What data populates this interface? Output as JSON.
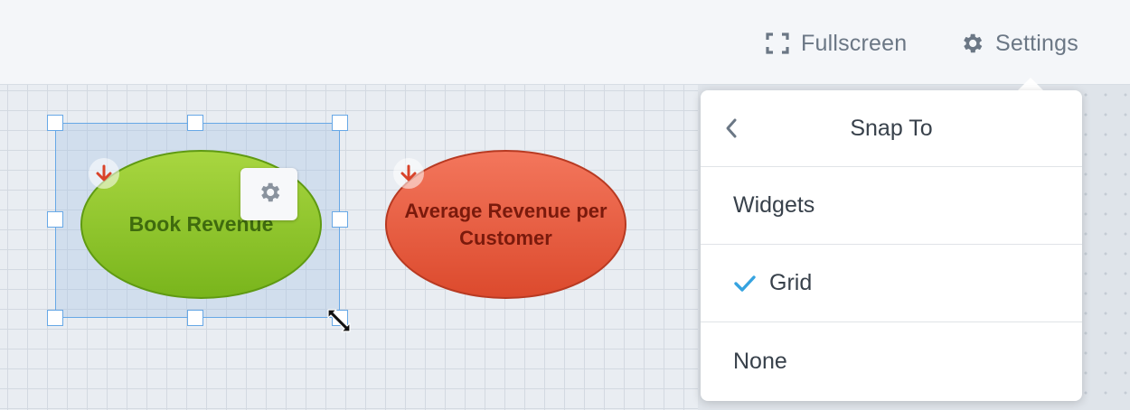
{
  "toolbar": {
    "fullscreen_label": "Fullscreen",
    "fullscreen_icon": "fullscreen-icon",
    "settings_label": "Settings",
    "settings_icon": "gear-icon"
  },
  "canvas": {
    "nodes": [
      {
        "label": "Book Revenue",
        "color": "#8cc631",
        "selected": true,
        "badge_icon": "arrow-down-icon"
      },
      {
        "label": "Average Revenue per Customer",
        "color": "#ec5a3e",
        "selected": false,
        "badge_icon": "arrow-down-icon"
      }
    ],
    "selected_node_action_icon": "gear-icon",
    "cursor_icon": "resize-diagonal-icon"
  },
  "snap_menu": {
    "title": "Snap To",
    "back_icon": "chevron-left-icon",
    "items": [
      {
        "label": "Widgets",
        "checked": false
      },
      {
        "label": "Grid",
        "checked": true
      },
      {
        "label": "None",
        "checked": false
      }
    ],
    "check_color": "#36a3e0"
  },
  "colors": {
    "selection": "#67a8e6",
    "toolbar_text": "#6b7785"
  }
}
